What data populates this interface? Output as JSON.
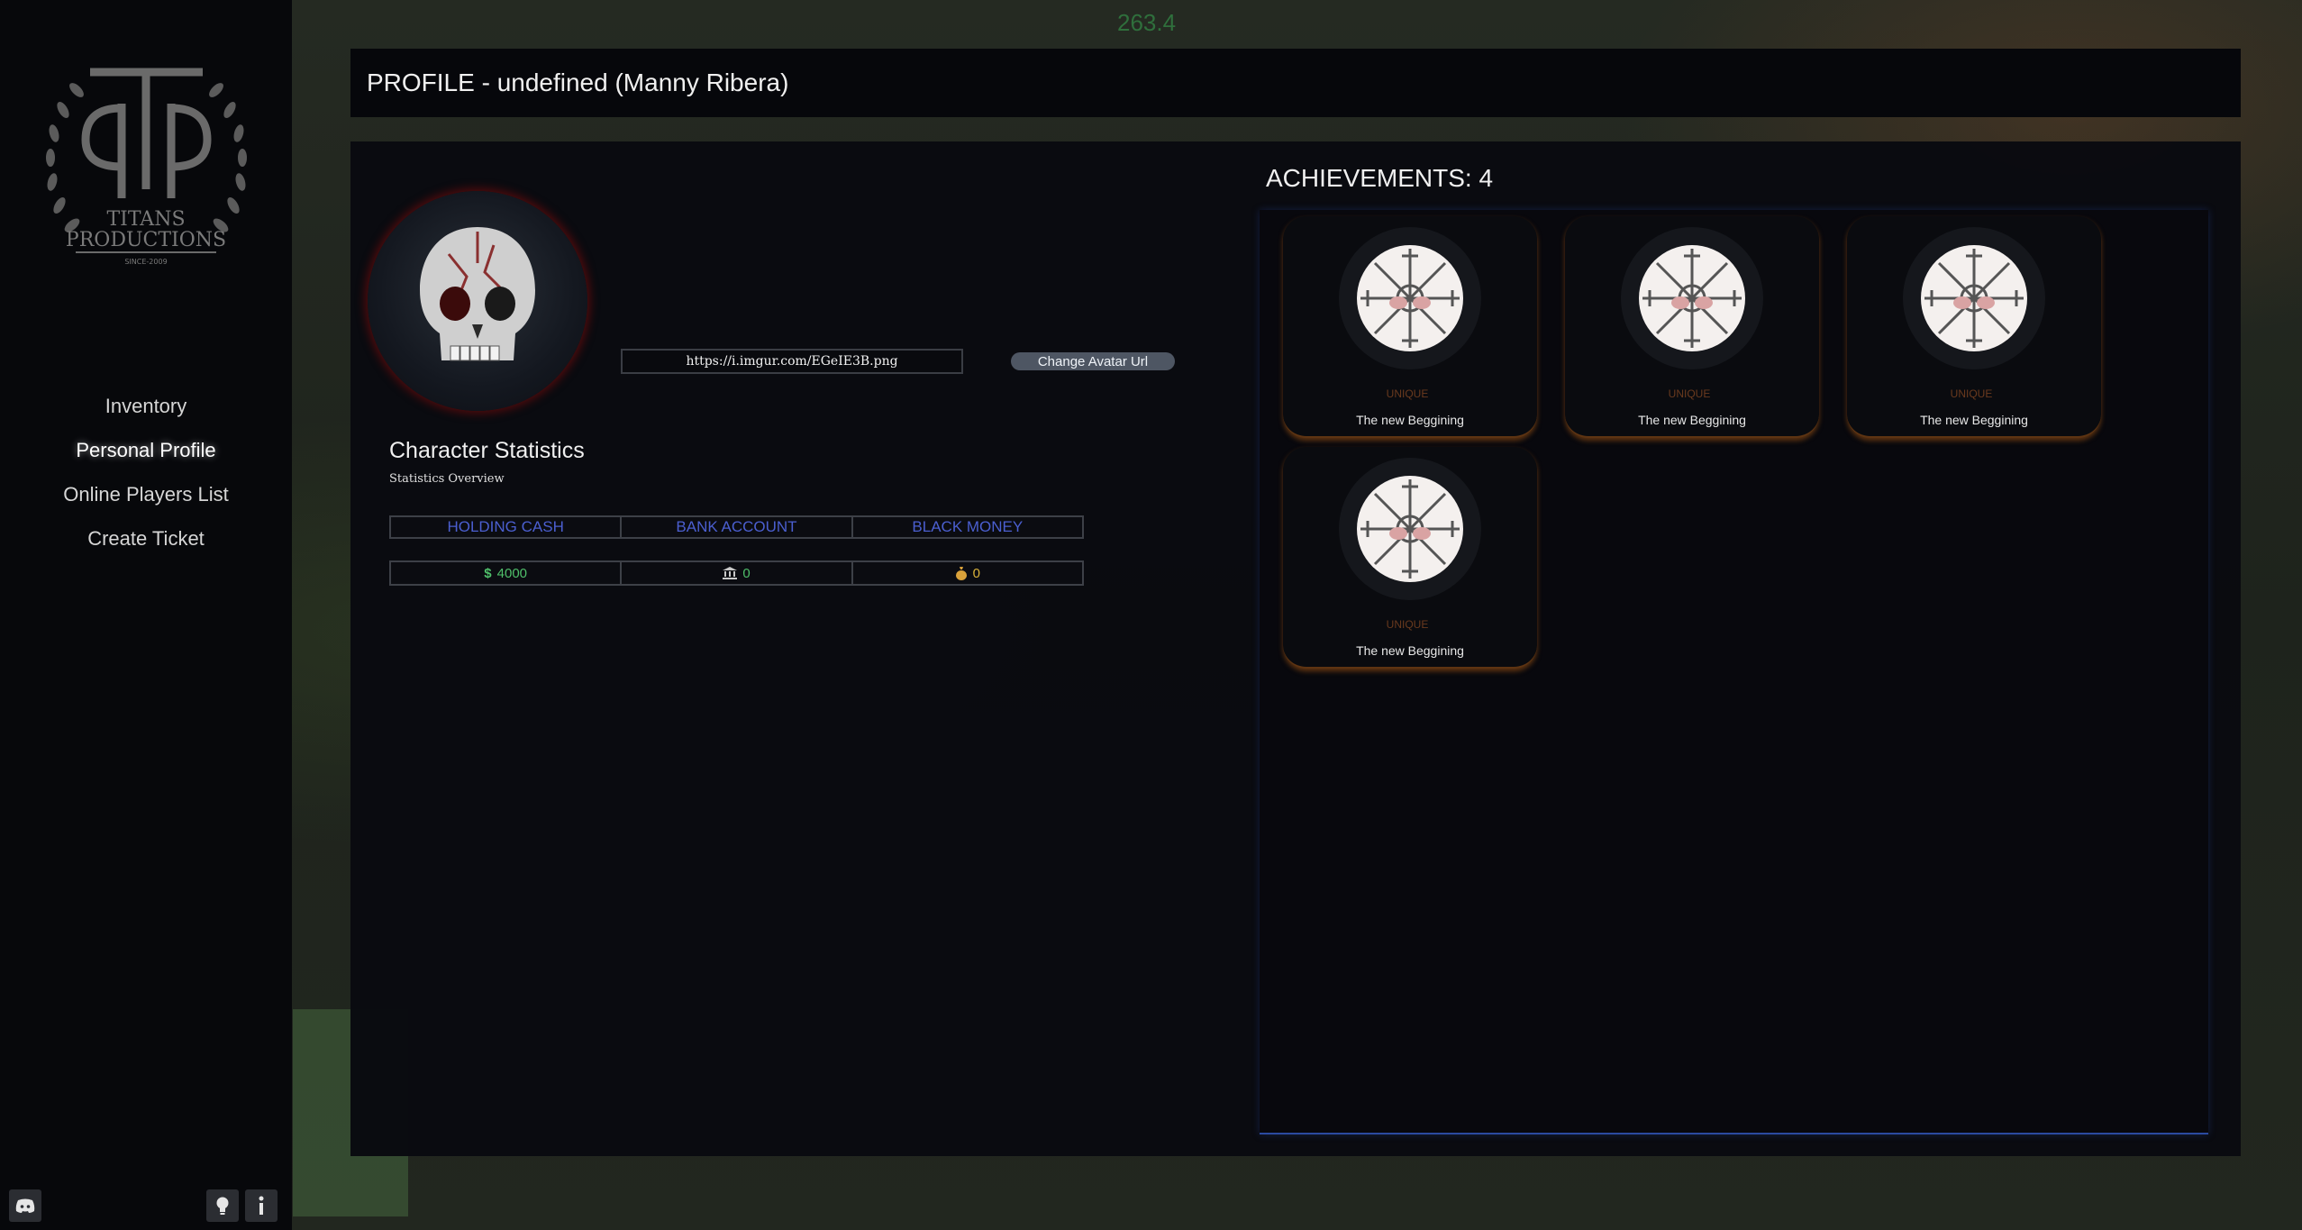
{
  "hud": {
    "speed": "263.4"
  },
  "sidebar": {
    "logo": {
      "name": "TITANS",
      "name2": "PRODUCTIONS",
      "since": "SINCE-2009"
    },
    "items": [
      {
        "label": "Inventory"
      },
      {
        "label": "Personal Profile",
        "active": true
      },
      {
        "label": "Online Players List"
      },
      {
        "label": "Create Ticket"
      }
    ],
    "icons": [
      "discord-icon",
      "lightbulb-icon",
      "info-icon"
    ]
  },
  "header": {
    "title": "PROFILE - undefined (Manny Ribera)"
  },
  "profile": {
    "avatar_url_value": "https://i.imgur.com/EGeIE3B.png",
    "change_avatar_label": "Change Avatar Url"
  },
  "stats": {
    "title": "Character Statistics",
    "subtitle": "Statistics Overview",
    "headers": [
      "HOLDING CASH",
      "BANK ACCOUNT",
      "BLACK MONEY"
    ],
    "values": [
      "4000",
      "0",
      "0"
    ],
    "value_icons": [
      "dollar-icon",
      "bank-icon",
      "money-bag-icon"
    ]
  },
  "achievements": {
    "title": "ACHIEVEMENTS: 4",
    "items": [
      {
        "rarity": "UNIQUE",
        "name": "The new Beggining"
      },
      {
        "rarity": "UNIQUE",
        "name": "The new Beggining"
      },
      {
        "rarity": "UNIQUE",
        "name": "The new Beggining"
      },
      {
        "rarity": "UNIQUE",
        "name": "The new Beggining"
      }
    ]
  },
  "colors": {
    "accent_blue": "#4b5fd0",
    "cash_green": "#4fbf6a",
    "gold": "#d9b23a",
    "rarity_orange": "#6a3a1e"
  }
}
